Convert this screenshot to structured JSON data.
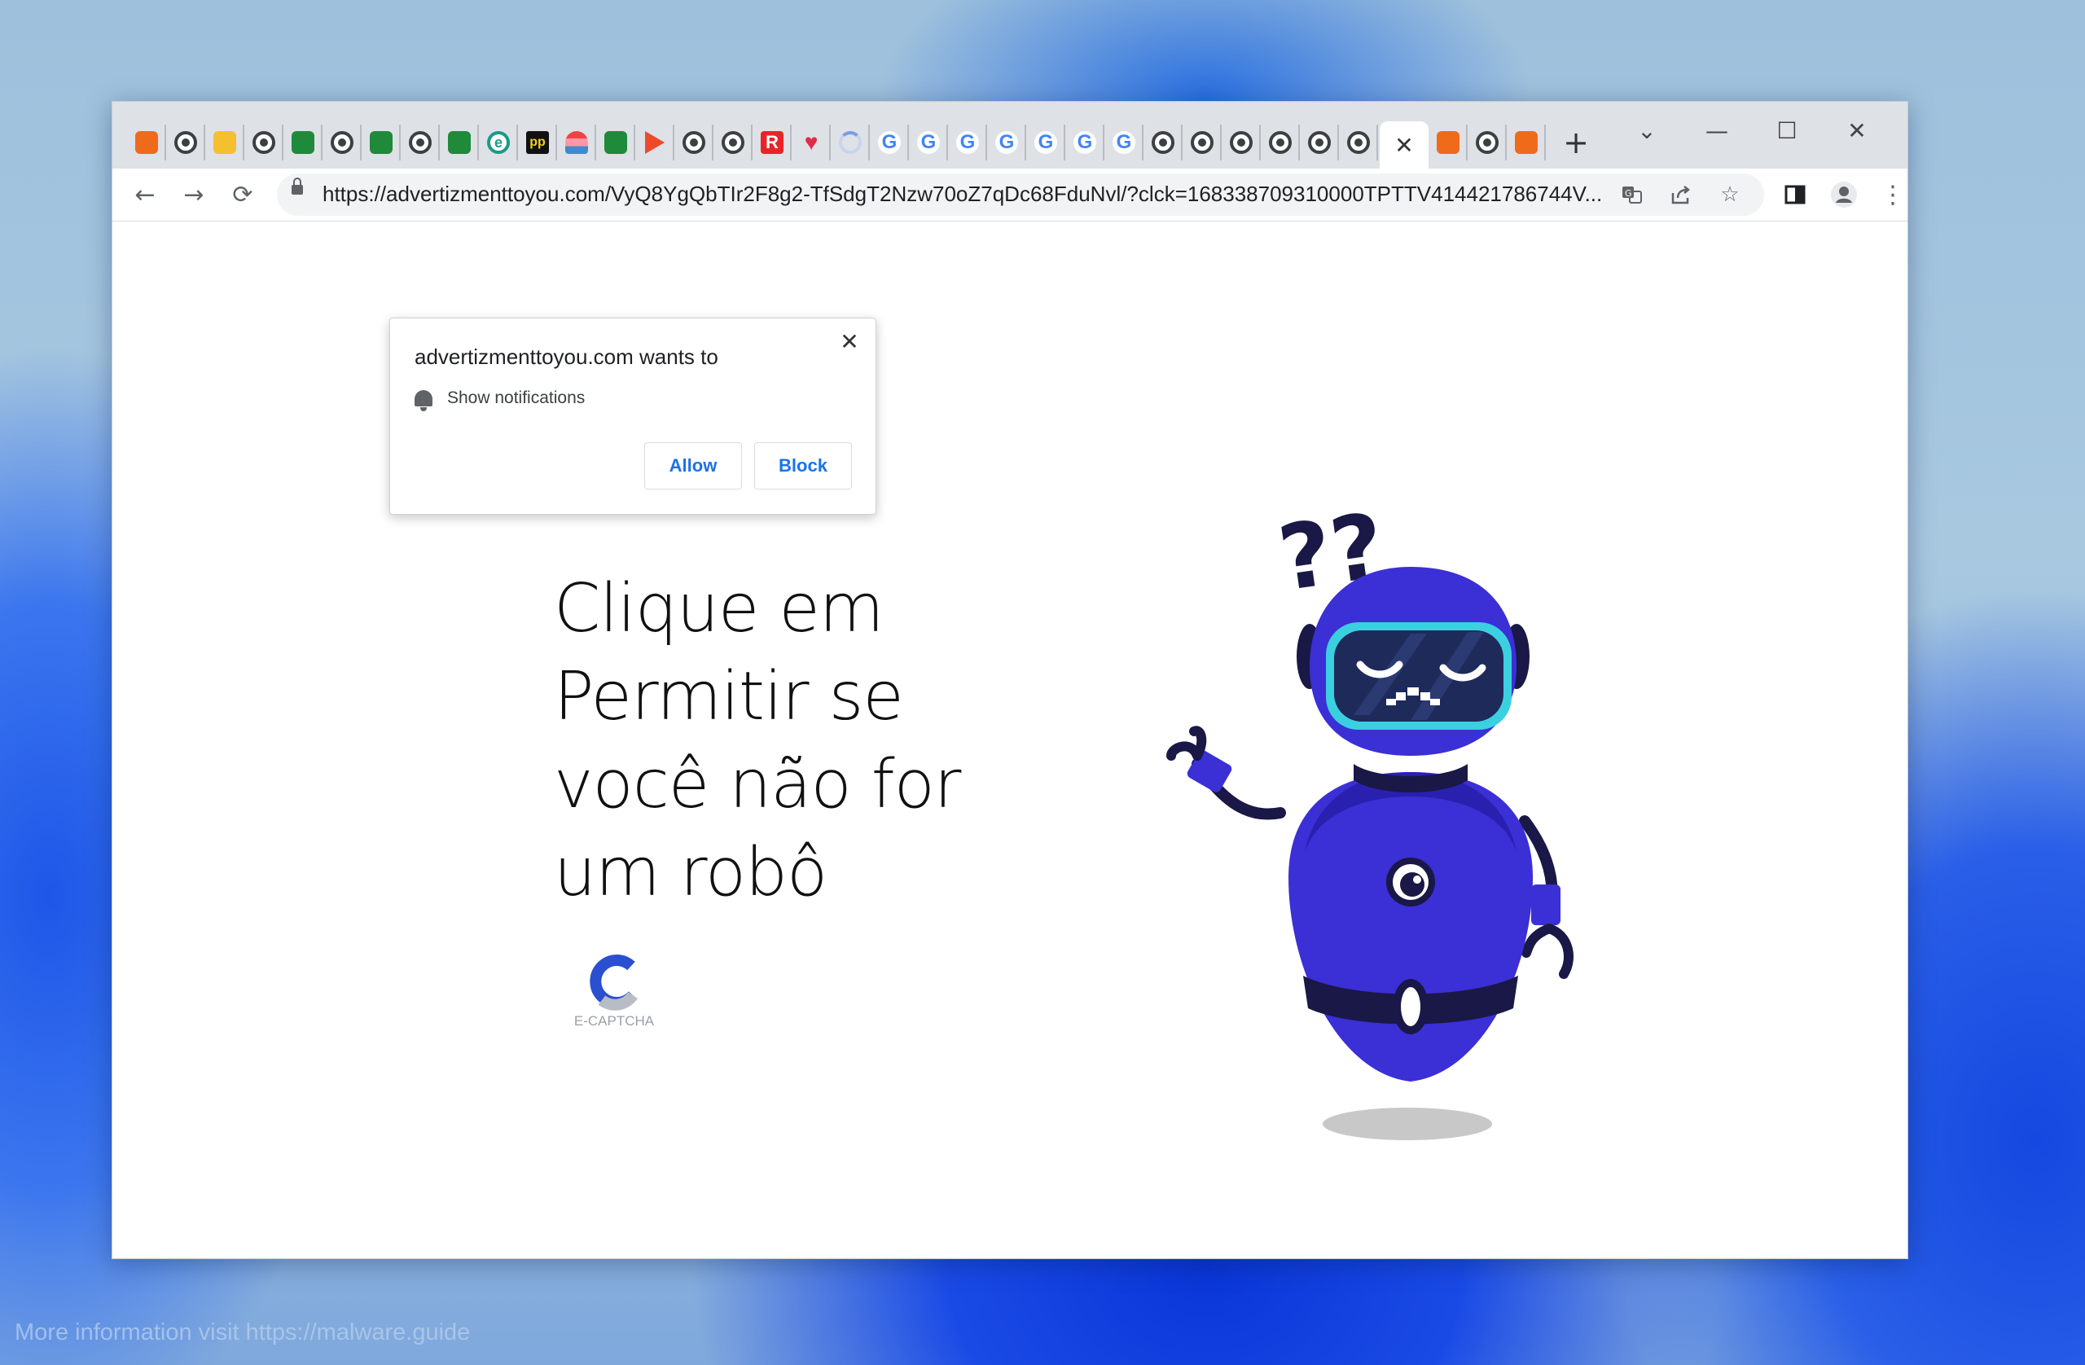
{
  "browser": {
    "url": "https://advertizmenttoyou.com/VyQ8YgQbTIr2F8g2-TfSdgT2Nzw70oZ7qDc68FduNvl/?clck=168338709310000TPTTV414421786744V...",
    "tabs": [
      {
        "icon": "b"
      },
      {
        "icon": "globe"
      },
      {
        "icon": "bee"
      },
      {
        "icon": "globe"
      },
      {
        "icon": "thumb"
      },
      {
        "icon": "globe"
      },
      {
        "icon": "thumb"
      },
      {
        "icon": "globe"
      },
      {
        "icon": "thumb"
      },
      {
        "icon": "e",
        "glyph": "e"
      },
      {
        "icon": "pp",
        "glyph": "pp"
      },
      {
        "icon": "rain"
      },
      {
        "icon": "thumb"
      },
      {
        "icon": "play"
      },
      {
        "icon": "globe"
      },
      {
        "icon": "globe"
      },
      {
        "icon": "r",
        "glyph": "R"
      },
      {
        "icon": "heart",
        "glyph": "♥"
      },
      {
        "icon": "load"
      },
      {
        "icon": "g",
        "glyph": "G"
      },
      {
        "icon": "g",
        "glyph": "G"
      },
      {
        "icon": "g",
        "glyph": "G"
      },
      {
        "icon": "g",
        "glyph": "G"
      },
      {
        "icon": "g",
        "glyph": "G"
      },
      {
        "icon": "g",
        "glyph": "G"
      },
      {
        "icon": "g",
        "glyph": "G"
      },
      {
        "icon": "globe"
      },
      {
        "icon": "globe"
      },
      {
        "icon": "globe"
      },
      {
        "icon": "globe"
      },
      {
        "icon": "globe"
      },
      {
        "icon": "globe"
      },
      {
        "icon": "active",
        "glyph": "✕"
      },
      {
        "icon": "b"
      },
      {
        "icon": "globe"
      },
      {
        "icon": "b"
      }
    ],
    "new_tab_glyph": "+",
    "tab_list_glyph": "⌄",
    "minimize_glyph": "—",
    "maximize_glyph": "☐",
    "close_glyph": "✕"
  },
  "popup": {
    "title": "advertizmenttoyou.com wants to",
    "permission": "Show notifications",
    "allow_label": "Allow",
    "block_label": "Block",
    "close_glyph": "✕"
  },
  "page": {
    "headline": "Clique em Permitir se você não for um robô",
    "captcha_label": "E-CAPTCHA"
  },
  "robot": {
    "question_marks": "??"
  },
  "watermark": "More information visit https://malware.guide",
  "colors": {
    "robot_body": "#3b2fd6",
    "robot_dark": "#1a1846",
    "visor": "#1e2a5a",
    "visor_rim": "#3ad0e0",
    "link_blue": "#1a73e8"
  }
}
